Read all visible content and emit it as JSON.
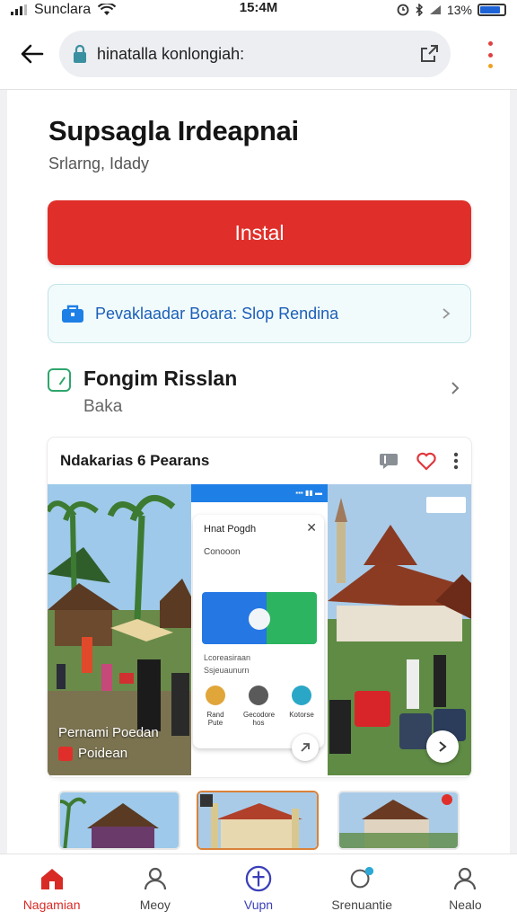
{
  "status_bar": {
    "carrier": "Sunclara",
    "time": "15:4M",
    "battery_text": "13%",
    "battery_level": 0.85
  },
  "browser": {
    "url": "hinatalla konlongiah:",
    "icons": {
      "back": "back-arrow-icon",
      "lock": "lock-icon",
      "share": "share-icon",
      "menu": "more-vert-icon"
    }
  },
  "app": {
    "title": "Supsagla Irdeapnai",
    "subtitle": "Srlarng, Idady",
    "install_label": "Instal"
  },
  "info_banner": {
    "text": "Pevaklaadar Boara: Slop Rendina"
  },
  "publisher": {
    "name": "Fongim Risslan",
    "sub": "Baka"
  },
  "gallery": {
    "title": "Ndakarias 6 Pearans",
    "caption_line1": "Pernami Poedan",
    "caption_line2": "Poidean",
    "mini_app": {
      "title": "Hnat Pogdh",
      "row1": "Conooon",
      "row2_a": "Lcoreasiraan",
      "row2_b": "Ssjeuaunurn",
      "items": [
        {
          "label": "Rand Pute",
          "color": "#e0a63a"
        },
        {
          "label": "Gecodore hos",
          "color": "#5a5a5a"
        },
        {
          "label": "Kotorse",
          "color": "#2aa7c7"
        }
      ]
    }
  },
  "bottom_nav": {
    "items": [
      {
        "label": "Nagamian",
        "icon": "home-icon",
        "active": true
      },
      {
        "label": "Meoy",
        "icon": "person-search-icon",
        "active": false
      },
      {
        "label": "Vupn",
        "icon": "compass-icon",
        "active": false
      },
      {
        "label": "Srenuantie",
        "icon": "chat-bubble-icon",
        "active": false
      },
      {
        "label": "Nealo",
        "icon": "person-icon",
        "active": false
      }
    ]
  },
  "colors": {
    "accent_red": "#e02f2a",
    "link_blue": "#1b5fb8",
    "publisher_green": "#2fa56b"
  }
}
